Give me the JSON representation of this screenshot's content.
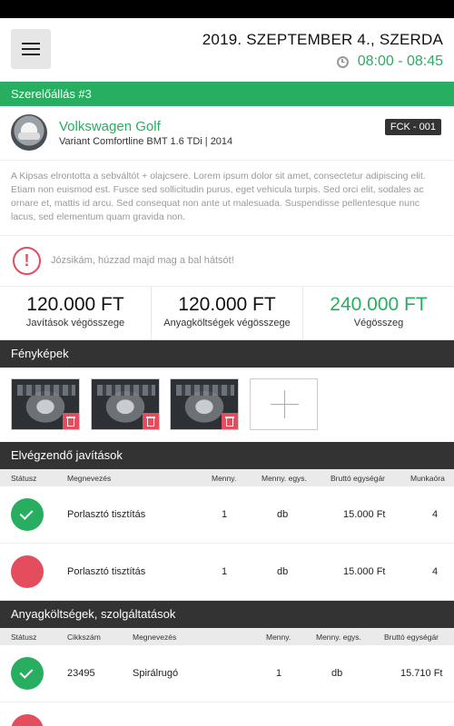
{
  "header": {
    "date": "2019. SZEPTEMBER 4., SZERDA",
    "time": "08:00 - 08:45"
  },
  "station": {
    "title": "Szerelőállás #3"
  },
  "car": {
    "name": "Volkswagen Golf",
    "variant": "Variant Comfortline BMT 1.6 TDi  |  2014",
    "plate": "FCK - 001"
  },
  "description": "A Kipsas elrontotta a sebváltót + olajcsere. Lorem ipsum dolor sit amet, consectetur adipiscing elit. Etiam non euismod est. Fusce sed sollicitudin purus, eget vehicula turpis. Sed orci elit, sodales ac ornare et, mattis id arcu. Sed consequat non ante ut malesuada. Suspendisse pellentesque nunc lacus, sed elementum quam gravida non.",
  "alert": {
    "text": "Józsikám, húzzad majd mag a bal hátsót!"
  },
  "totals": [
    {
      "value": "120.000 FT",
      "label": "Javítások végösszege"
    },
    {
      "value": "120.000 FT",
      "label": "Anyagköltségek végösszege"
    },
    {
      "value": "240.000 FT",
      "label": "Végösszeg"
    }
  ],
  "photos": {
    "title": "Fényképek"
  },
  "repairs": {
    "title": "Elvégzendő javítások",
    "columns": [
      "Státusz",
      "Megnevezés",
      "Menny.",
      "Menny. egys.",
      "Bruttó egységár",
      "Munkaóra"
    ],
    "rows": [
      {
        "status": "done",
        "name": "Porlasztó tisztítás",
        "qty": "1",
        "unit": "db",
        "price": "15.000 Ft",
        "hours": "4"
      },
      {
        "status": "todo",
        "name": "Porlasztó tisztítás",
        "qty": "1",
        "unit": "db",
        "price": "15.000 Ft",
        "hours": "4"
      }
    ]
  },
  "materials": {
    "title": "Anyagköltségek, szolgáltatások",
    "columns": [
      "Státusz",
      "Cikkszám",
      "Megnevezés",
      "Menny.",
      "Menny. egys.",
      "Bruttó egységár"
    ],
    "rows": [
      {
        "status": "done",
        "sku": "23495",
        "name": "Spirálrugó",
        "qty": "1",
        "unit": "db",
        "price": "15.710 Ft"
      }
    ]
  },
  "colors": {
    "accent": "#27ae60",
    "danger": "#e44d5e",
    "dark": "#333333"
  }
}
